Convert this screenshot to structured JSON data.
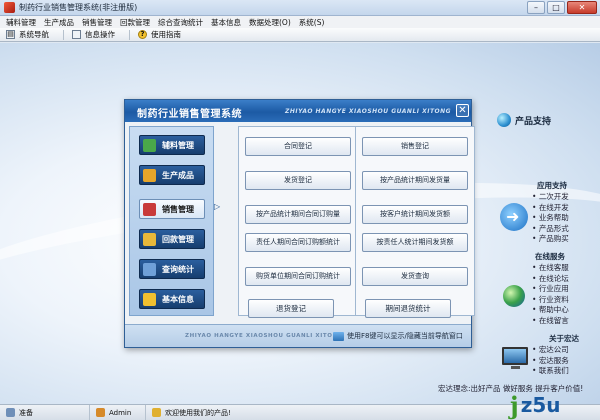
{
  "window": {
    "title": "制药行业销售管理系统(非注册版)",
    "controls": [
      "–",
      "□",
      "✕"
    ]
  },
  "menu": [
    "辅料管理",
    "生产成品",
    "销售管理",
    "回款管理",
    "综合查询统计",
    "基本信息",
    "数据处理(O)",
    "系统(S)"
  ],
  "toolbar": {
    "items": [
      "系统导航",
      "信息操作",
      "使用指南"
    ]
  },
  "dialog": {
    "title": "制药行业销售管理系统",
    "subtitle": "ZHIYAO HANGYE XIAOSHOU GUANLI XITONG",
    "close": "✕",
    "nav": [
      {
        "label": "辅料管理",
        "color": "#4aa84a"
      },
      {
        "label": "生产成品",
        "color": "#e6a52a"
      },
      {
        "label": "销售管理",
        "color": "#c83a3a",
        "active": true
      },
      {
        "label": "回款管理",
        "color": "#e8b83a"
      },
      {
        "label": "查询统计",
        "color": "#6fa0d8"
      },
      {
        "label": "基本信息",
        "color": "#f0c030"
      }
    ],
    "nav_arrow": "▷",
    "left_actions": [
      "合同登记",
      "发货登记",
      "按产品统计期间合同订购量",
      "责任人期间合同订购额统计",
      "购货单位期间合同订购统计"
    ],
    "right_actions": [
      "销售登记",
      "按产品统计期间发货量",
      "按客户统计期间发货额",
      "按责任人统计期间发货额",
      "发货查询"
    ],
    "bottom_actions": [
      "退货登记",
      "期间退货统计"
    ],
    "footer_sub": "ZHIYAO HANGYE XIAOSHOU GUANLI XITONG",
    "footer_hint": "使用F8键可以显示/隐藏当前导航窗口"
  },
  "right_panel": {
    "title": "产品支持",
    "sec1": "应用支持",
    "list1": [
      "二次开发",
      "在线开发",
      "业务帮助",
      "产品形式",
      "产品购买"
    ],
    "sec2": "在线服务",
    "list2": [
      "在线客服",
      "在线论坛",
      "行业应用",
      "行业资料",
      "帮助中心",
      "在线留言"
    ],
    "sec3": "关于宏达",
    "list3": [
      "宏达公司",
      "宏达服务",
      "联系我们"
    ],
    "footer": "宏达理念:出好产品 做好服务 提升客户价值!"
  },
  "status": {
    "ready": "准备",
    "user": "Admin",
    "welcome": "欢迎使用我们的产品!"
  },
  "watermark": {
    "j": "j",
    "rest": "z5u"
  }
}
